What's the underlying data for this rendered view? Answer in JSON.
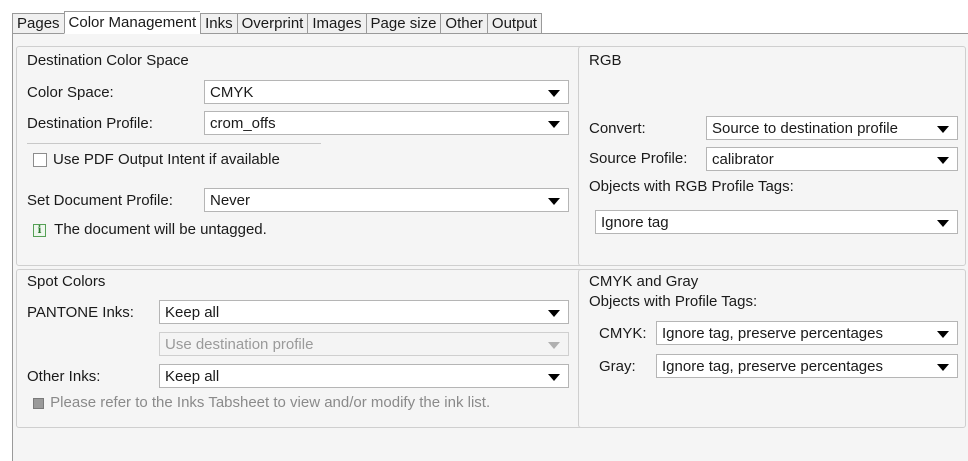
{
  "tabs": [
    "Pages",
    "Color Management",
    "Inks",
    "Overprint",
    "Images",
    "Page size",
    "Other",
    "Output"
  ],
  "active_tab": "Color Management",
  "destination": {
    "title": "Destination Color Space",
    "color_space_label": "Color Space:",
    "color_space_value": "CMYK",
    "dest_profile_label": "Destination Profile:",
    "dest_profile_value": "crom_offs",
    "use_output_intent_label": "Use PDF Output Intent if available",
    "use_output_intent_checked": false,
    "set_doc_profile_label": "Set Document Profile:",
    "set_doc_profile_value": "Never",
    "info_icon": "info-icon",
    "info_text": "The document will be untagged."
  },
  "rgb": {
    "title": "RGB",
    "convert_label": "Convert:",
    "convert_value": "Source to destination profile",
    "source_profile_label": "Source Profile:",
    "source_profile_value": "calibrator",
    "objects_label": "Objects with RGB Profile Tags:",
    "objects_value": "Ignore tag"
  },
  "spot": {
    "title": "Spot Colors",
    "pantone_label": "PANTONE Inks:",
    "pantone_value": "Keep all",
    "pantone_sub_value": "Use destination profile",
    "other_label": "Other Inks:",
    "other_value": "Keep all",
    "note_text": "Please refer to the Inks Tabsheet to view and/or modify the ink list."
  },
  "cmyk_gray": {
    "title": "CMYK and Gray",
    "objects_label": "Objects with Profile Tags:",
    "cmyk_label": "CMYK:",
    "cmyk_value": "Ignore tag, preserve percentages",
    "gray_label": "Gray:",
    "gray_value": "Ignore tag, preserve percentages"
  }
}
